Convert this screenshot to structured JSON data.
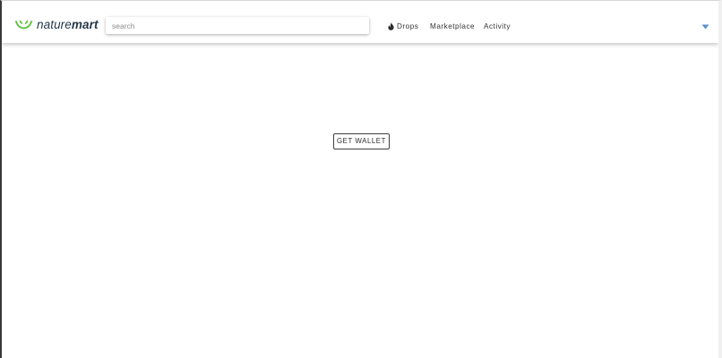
{
  "header": {
    "logo": {
      "icon": "naturemart-leaf-smile-logo",
      "text_light": "nature",
      "text_bold": "mart",
      "brand_color": "#24384a",
      "accent_color": "#5bbf3c"
    },
    "search": {
      "placeholder": "search",
      "value": ""
    },
    "nav": {
      "drops": {
        "label": "Drops",
        "icon": "fire-icon"
      },
      "marketplace": {
        "label": "Marketplace"
      },
      "activity": {
        "label": "Activity"
      }
    },
    "account_menu": {
      "icon": "caret-down-icon",
      "color": "#5b8fc7"
    }
  },
  "main": {
    "get_wallet_label": "GET WALLET"
  }
}
